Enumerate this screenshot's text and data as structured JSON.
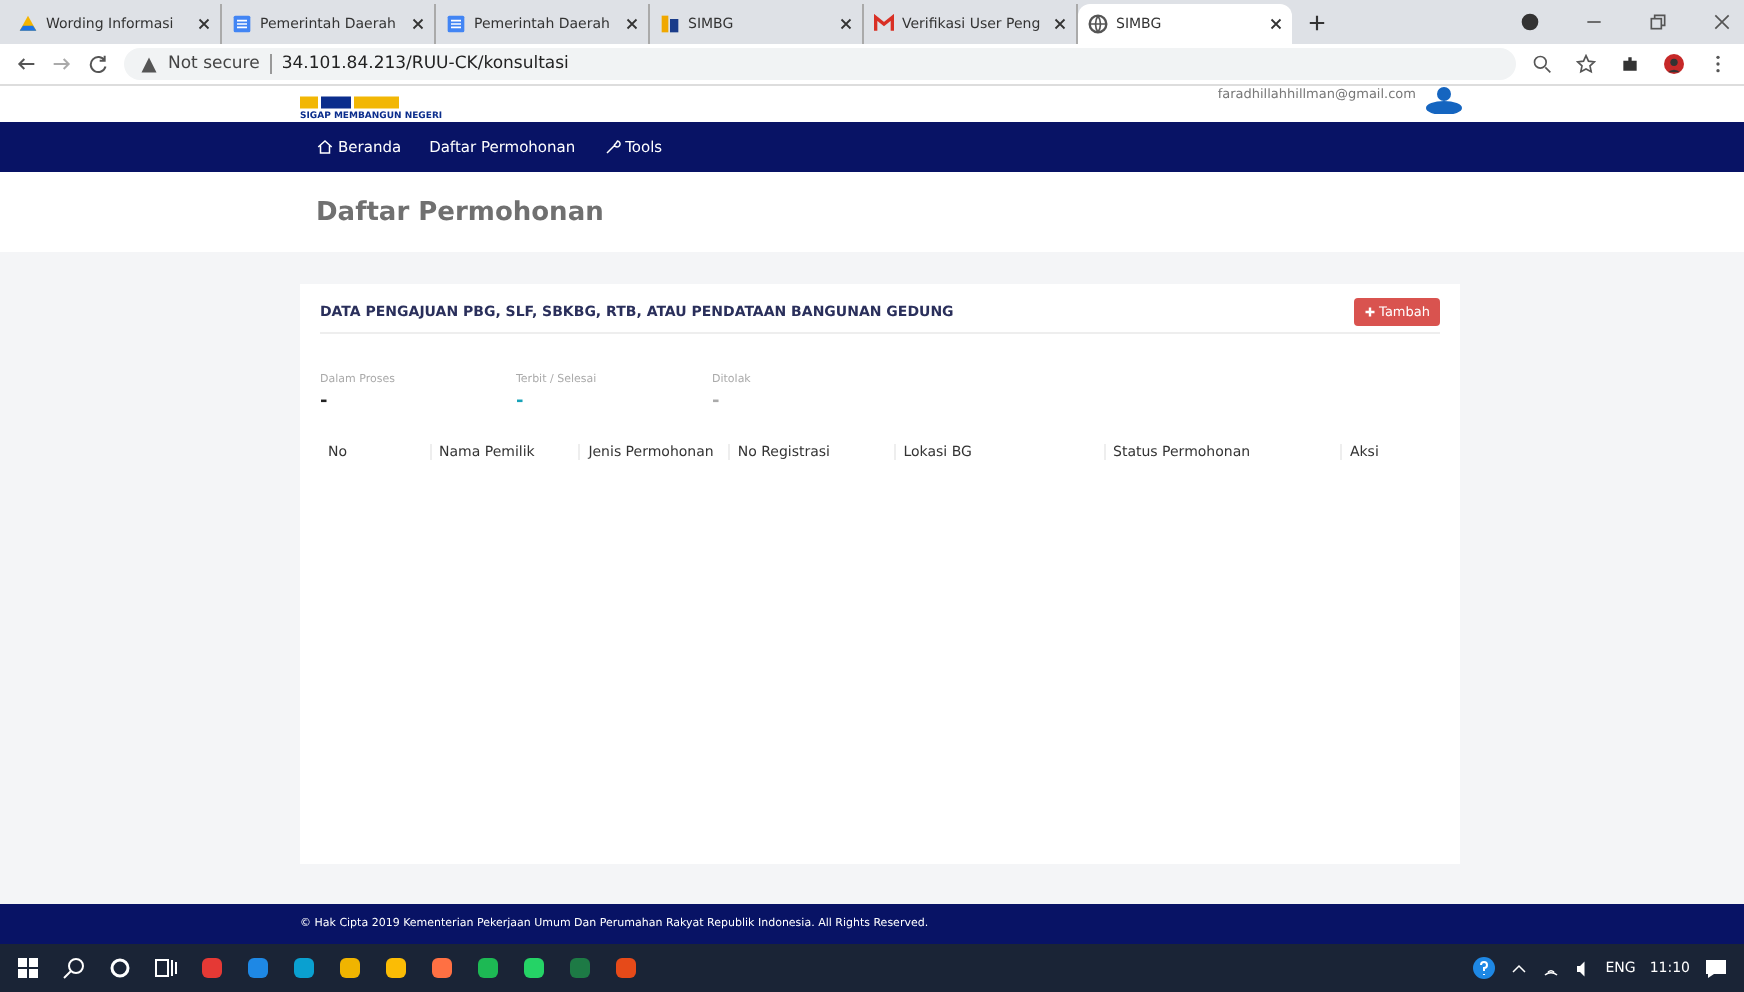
{
  "browser": {
    "tabs": [
      {
        "title": "Wording Informasi",
        "selected": false,
        "kind": "drive"
      },
      {
        "title": "Pemerintah Daerah",
        "selected": false,
        "kind": "doc"
      },
      {
        "title": "Pemerintah Daerah",
        "selected": false,
        "kind": "doc"
      },
      {
        "title": "SIMBG",
        "selected": false,
        "kind": "simbg"
      },
      {
        "title": "Verifikasi User Peng",
        "selected": false,
        "kind": "gmail"
      },
      {
        "title": "SIMBG",
        "selected": true,
        "kind": "globe"
      }
    ],
    "security": "Not secure",
    "url": "34.101.84.213/RUU-CK/konsultasi"
  },
  "header": {
    "tagline": "SIGAP MEMBANGUN NEGERI",
    "user_email": "faradhillahhillman@gmail.com"
  },
  "nav": [
    {
      "label": "Beranda"
    },
    {
      "label": "Daftar Permohonan"
    },
    {
      "label": "Tools"
    }
  ],
  "page_title": "Daftar Permohonan",
  "card": {
    "title": "DATA PENGAJUAN PBG, SLF, SBKBG, RTB, ATAU PENDATAAN BANGUNAN GEDUNG",
    "add_button": "Tambah",
    "stats": [
      {
        "label": "Dalam Proses",
        "value": "-",
        "color": "#222222"
      },
      {
        "label": "Terbit / Selesai",
        "value": "-",
        "color": "#17a2b8"
      },
      {
        "label": "Ditolak",
        "value": "-",
        "color": "#aaaaaa"
      }
    ],
    "table": {
      "columns": [
        "No",
        "Nama Pemilik",
        "Jenis Permohonan",
        "No Registrasi",
        "Lokasi BG",
        "Status Permohonan",
        "Aksi"
      ]
    }
  },
  "footer": "© Hak Cipta 2019 Kementerian Pekerjaan Umum Dan Perumahan Rakyat Republik Indonesia. All Rights Reserved.",
  "taskbar": {
    "apps": [
      {
        "color": "#e53935"
      },
      {
        "color": "#1e88e5"
      },
      {
        "color": "#0aa0d0"
      },
      {
        "color": "#f0b400"
      },
      {
        "color": "#fbbc05"
      },
      {
        "color": "#ff7043"
      },
      {
        "color": "#1db954"
      },
      {
        "color": "#25d366"
      },
      {
        "color": "#1d7a45"
      },
      {
        "color": "#e64a19"
      }
    ],
    "language": "ENG",
    "time": "11:10"
  }
}
